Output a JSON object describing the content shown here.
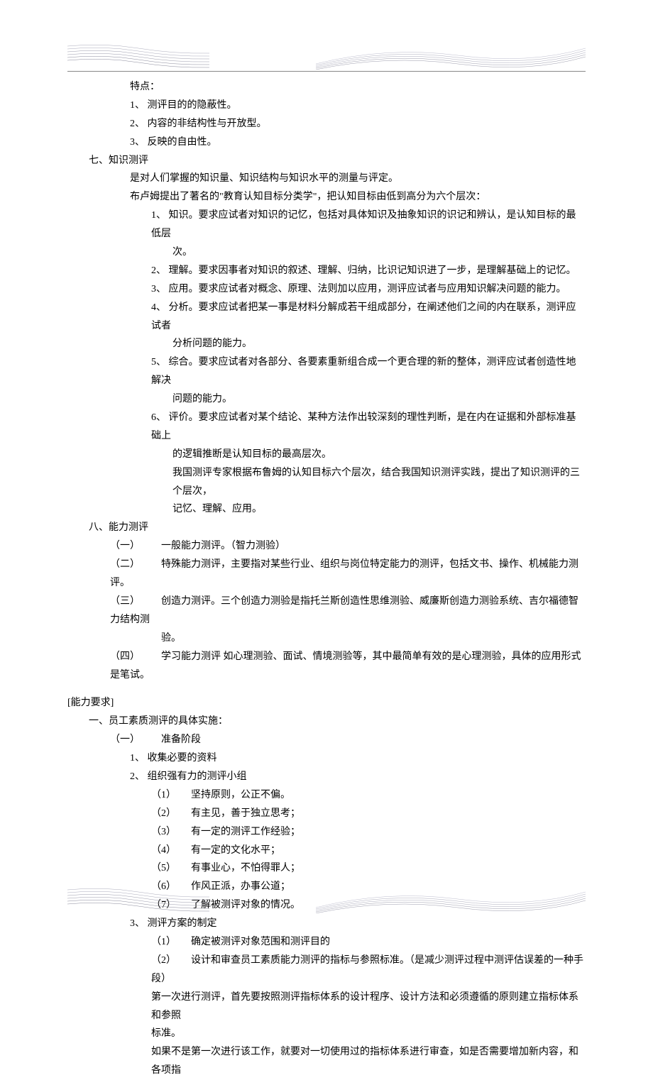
{
  "section_top": {
    "features_label": "特点：",
    "features": [
      "1、 测评目的的隐蔽性。",
      "2、 内容的非结构性与开放型。",
      "3、 反映的自由性。"
    ]
  },
  "section7": {
    "heading": "七、知识测评",
    "intro1": "是对人们掌握的知识量、知识结构与知识水平的测量与评定。",
    "intro2": "布卢姆提出了著名的\"教育认知目标分类学\"，把认知目标由低到高分为六个层次：",
    "items": [
      {
        "num": "1、",
        "a": "知识。要求应试者对知识的记忆，包括对具体知识及抽象知识的识记和辨认，是认知目标的最低层",
        "b": "次。"
      },
      {
        "num": "2、",
        "a": "理解。要求因事者对知识的叙述、理解、归纳，比识记知识进了一步，是理解基础上的记忆。"
      },
      {
        "num": "3、",
        "a": "应用。要求应试者对概念、原理、法则加以应用，测评应试者与应用知识解决问题的能力。"
      },
      {
        "num": "4、",
        "a": "分析。要求应试者把某一事是材料分解成若干组成部分，在阐述他们之间的内在联系，测评应试者",
        "b": "分析问题的能力。"
      },
      {
        "num": "5、",
        "a": "综合。要求应试者对各部分、各要素重新组合成一个更合理的新的整体，测评应试者创造性地解决",
        "b": "问题的能力。"
      },
      {
        "num": "6、",
        "a": "评价。要求应试者对某个结论、某种方法作出较深刻的理性判断，是在内在证据和外部标准基础上",
        "b": "的逻辑推断是认知目标的最高层次。"
      }
    ],
    "tail1": "我国测评专家根据布鲁姆的认知目标六个层次，结合我国知识测评实践，提出了知识测评的三个层次，",
    "tail2": "记忆、理解、应用。"
  },
  "section8": {
    "heading": "八、能力测评",
    "items": [
      {
        "label": "（一）",
        "text": "一般能力测评。（智力测验）"
      },
      {
        "label": "（二）",
        "text": "特殊能力测评，主要指对某些行业、组织与岗位特定能力的测评，包括文书、操作、机械能力测评。"
      },
      {
        "label": "（三）",
        "text": "创造力测评。三个创造力测验是指托兰斯创造性思维测验、威廉斯创造力测验系统、吉尔福德智力结构测",
        "text2": "验。"
      },
      {
        "label": "（四）",
        "text": "学习能力测评 如心理测验、面试、情境测验等，其中最简单有效的是心理测验，具体的应用形式是笔试。"
      }
    ]
  },
  "ability_req": {
    "heading": "[能力要求]",
    "sub1": "一、员工素质测评的具体实施：",
    "prep_label": "（一）",
    "prep_text": "准备阶段",
    "g1_label": "1、",
    "g1_text": "收集必要的资料",
    "g2_label": "2、",
    "g2_text": "组织强有力的测评小组",
    "g2_items": [
      {
        "n": "（1）",
        "t": "坚持原则，公正不偏。"
      },
      {
        "n": "（2）",
        "t": "有主见，善于独立思考；"
      },
      {
        "n": "（3）",
        "t": "有一定的测评工作经验；"
      },
      {
        "n": "（4）",
        "t": "有一定的文化水平；"
      },
      {
        "n": "（5）",
        "t": "有事业心，不怕得罪人；"
      },
      {
        "n": "（6）",
        "t": "作风正派，办事公道；"
      },
      {
        "n": "（7）",
        "t": "了解被测评对象的情况。"
      }
    ],
    "g3_label": "3、",
    "g3_text": "测评方案的制定",
    "g3_1_n": "（1）",
    "g3_1_t": "确定被测评对象范围和测评目的",
    "g3_2_n": "（2）",
    "g3_2_t": "设计和审查员工素质能力测评的指标与参照标准。（是减少测评过程中测评估误差的一种手段）",
    "g3_p1a": "第一次进行测评，首先要按照测评指标体系的设计程序、设计方法和必须遵循的原则建立指标体系和参照",
    "g3_p1b": "标准。",
    "g3_p2": "如果不是第一次进行该工作，就要对一切使用过的指标体系进行审查，如是否需要增加新内容，和各项指"
  }
}
